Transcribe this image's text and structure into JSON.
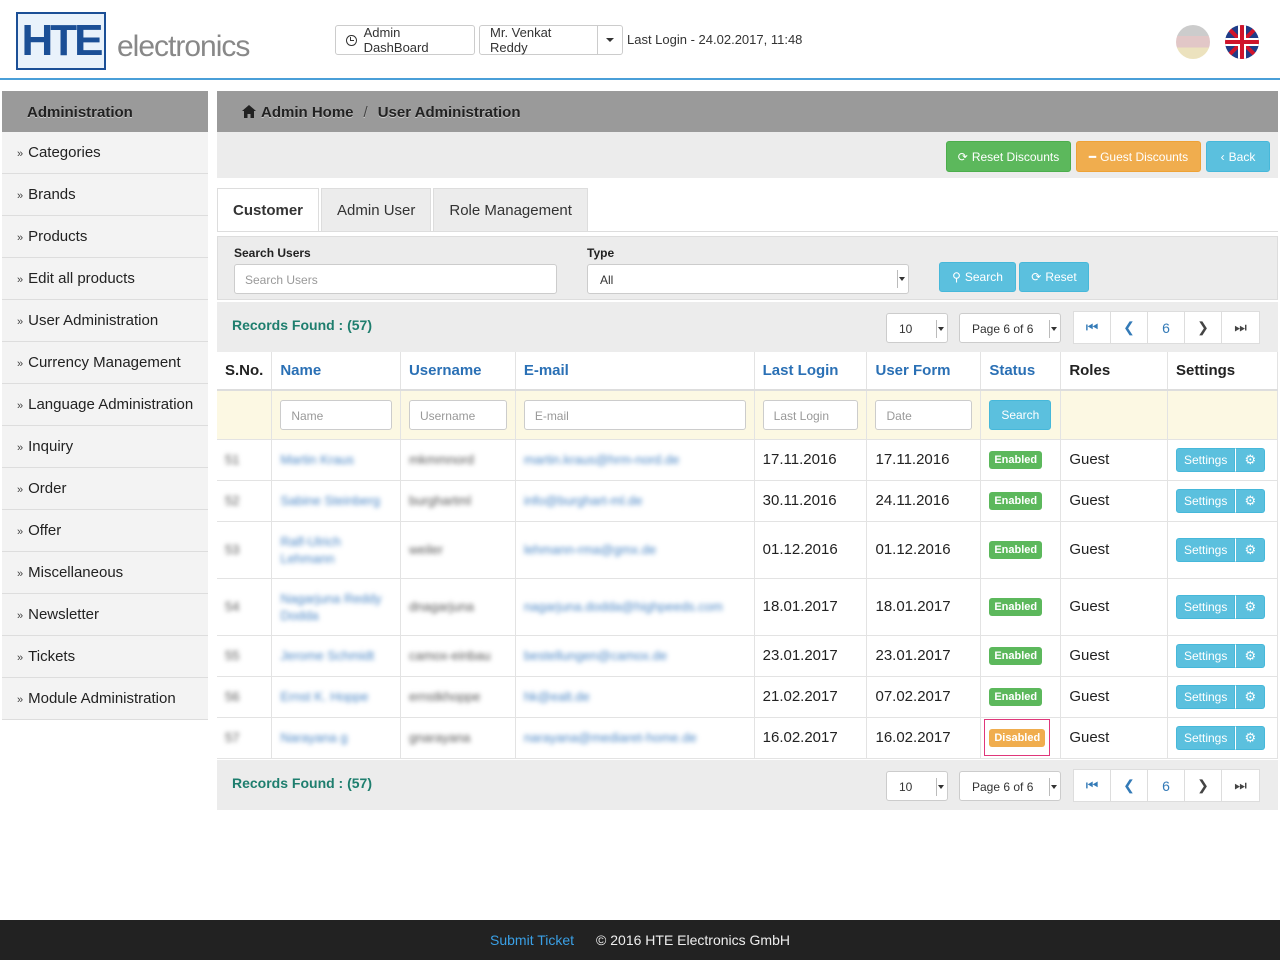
{
  "header": {
    "logo_letters": "HTE",
    "logo_text": "electronics",
    "dashboard_label": "Admin DashBoard",
    "user_name": "Mr. Venkat Reddy",
    "last_login": "Last Login - 24.02.2017, 11:48",
    "flags": [
      "german-flag-icon",
      "uk-flag-icon"
    ]
  },
  "sidebar": {
    "title": "Administration",
    "items": [
      {
        "label": "Categories"
      },
      {
        "label": "Brands"
      },
      {
        "label": "Products"
      },
      {
        "label": "Edit all products"
      },
      {
        "label": "User Administration"
      },
      {
        "label": "Currency Management"
      },
      {
        "label": "Language Administration"
      },
      {
        "label": "Inquiry"
      },
      {
        "label": "Order"
      },
      {
        "label": "Offer"
      },
      {
        "label": "Miscellaneous"
      },
      {
        "label": "Newsletter"
      },
      {
        "label": "Tickets"
      },
      {
        "label": "Module Administration"
      }
    ]
  },
  "breadcrumb": {
    "home": "Admin Home",
    "sep": "/",
    "current": "User Administration"
  },
  "toolbar": {
    "reset_discounts": "Reset Discounts",
    "guest_discounts": "Guest Discounts",
    "back": "Back"
  },
  "tabs": [
    {
      "label": "Customer",
      "active": true
    },
    {
      "label": "Admin User",
      "active": false
    },
    {
      "label": "Role Management",
      "active": false
    }
  ],
  "search": {
    "users_label": "Search Users",
    "users_placeholder": "Search Users",
    "type_label": "Type",
    "type_value": "All",
    "search_button": "Search",
    "reset_button": "Reset"
  },
  "records": {
    "text": "Records Found : (57)",
    "page_size": "10",
    "page_select": "Page 6 of 6",
    "current_page": "6"
  },
  "table": {
    "headers": [
      "S.No.",
      "Name",
      "Username",
      "E-mail",
      "Last Login",
      "User Form",
      "Status",
      "Roles",
      "Settings"
    ],
    "filters": {
      "name": "Name",
      "username": "Username",
      "email": "E-mail",
      "last_login": "Last Login",
      "date": "Date",
      "search": "Search"
    },
    "rows": [
      {
        "sno": "51",
        "name": "Martin Kraus",
        "username": "mkmmnord",
        "email": "martin.kraus@hrm-nord.de",
        "last_login": "17.11.2016",
        "user_form": "17.11.2016",
        "status": "Enabled",
        "role": "Guest",
        "settings": "Settings"
      },
      {
        "sno": "52",
        "name": "Sabine Steinberg",
        "username": "burghartml",
        "email": "info@burghart-ml.de",
        "last_login": "30.11.2016",
        "user_form": "24.11.2016",
        "status": "Enabled",
        "role": "Guest",
        "settings": "Settings"
      },
      {
        "sno": "53",
        "name": "Ralf-Ulrich Lehmann",
        "username": "weiler",
        "email": "lehmann-rma@gmx.de",
        "last_login": "01.12.2016",
        "user_form": "01.12.2016",
        "status": "Enabled",
        "role": "Guest",
        "settings": "Settings"
      },
      {
        "sno": "54",
        "name": "Nagarjuna Reddy Dodda",
        "username": "dnagarjuna",
        "email": "nagarjuna.dodda@highpeeds.com",
        "last_login": "18.01.2017",
        "user_form": "18.01.2017",
        "status": "Enabled",
        "role": "Guest",
        "settings": "Settings"
      },
      {
        "sno": "55",
        "name": "Jerome Schmidt",
        "username": "camox-einbau",
        "email": "bestellungen@camox.de",
        "last_login": "23.01.2017",
        "user_form": "23.01.2017",
        "status": "Enabled",
        "role": "Guest",
        "settings": "Settings"
      },
      {
        "sno": "56",
        "name": "Ernst K. Hoppe",
        "username": "ernstkhoppe",
        "email": "hk@ealt.de",
        "last_login": "21.02.2017",
        "user_form": "07.02.2017",
        "status": "Enabled",
        "role": "Guest",
        "settings": "Settings"
      },
      {
        "sno": "57",
        "name": "Narayana g",
        "username": "gnarayana",
        "email": "narayana@mediaret-home.de",
        "last_login": "16.02.2017",
        "user_form": "16.02.2017",
        "status": "Disabled",
        "role": "Guest",
        "settings": "Settings"
      }
    ]
  },
  "footer": {
    "submit_ticket": "Submit Ticket",
    "copyright": "© 2016 HTE Electronics GmbH"
  },
  "colors": {
    "accent_blue": "#5bc0de",
    "success": "#5cb85c",
    "warning": "#f0ad4e",
    "header_gray": "#9a9a9a",
    "highlight": "#e0367a"
  }
}
